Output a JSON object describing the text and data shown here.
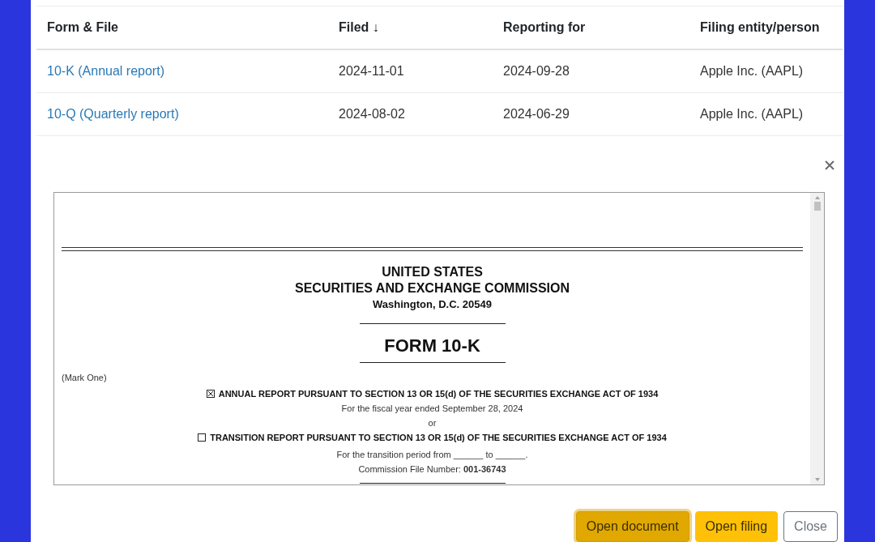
{
  "table": {
    "columns": [
      "Form & File",
      "Filed ↓",
      "Reporting for",
      "Filing entity/person"
    ],
    "rows": [
      {
        "form": "10-K (Annual report)",
        "filed": "2024-11-01",
        "reporting_for": "2024-09-28",
        "entity": "Apple Inc. (AAPL)"
      },
      {
        "form": "10-Q (Quarterly report)",
        "filed": "2024-08-02",
        "reporting_for": "2024-06-29",
        "entity": "Apple Inc. (AAPL)"
      }
    ]
  },
  "preview": {
    "document": {
      "heading": [
        "UNITED STATES",
        "SECURITIES AND EXCHANGE COMMISSION"
      ],
      "address": "Washington, D.C. 20549",
      "form": "FORM 10-K",
      "mark_one": "(Mark One)",
      "options": [
        {
          "label": "ANNUAL REPORT PURSUANT TO SECTION 13 OR 15(d) OF THE SECURITIES EXCHANGE ACT OF 1934",
          "checked": true,
          "detail": "For the fiscal year ended September 28, 2024"
        },
        {
          "label": "TRANSITION REPORT PURSUANT TO SECTION 13 OR 15(d) OF THE SECURITIES EXCHANGE ACT OF 1934",
          "checked": false,
          "detail": "For the transition period from ______ to ______."
        }
      ],
      "separator": "or",
      "file_number": "Commission File Number: **001-36743**"
    }
  },
  "buttons": [
    {
      "label": "Open document",
      "kind": "primary",
      "focused": true
    },
    {
      "label": "Open filing",
      "kind": "primary",
      "focused": false
    },
    {
      "label": "Close",
      "kind": "secondary",
      "focused": false
    }
  ]
}
